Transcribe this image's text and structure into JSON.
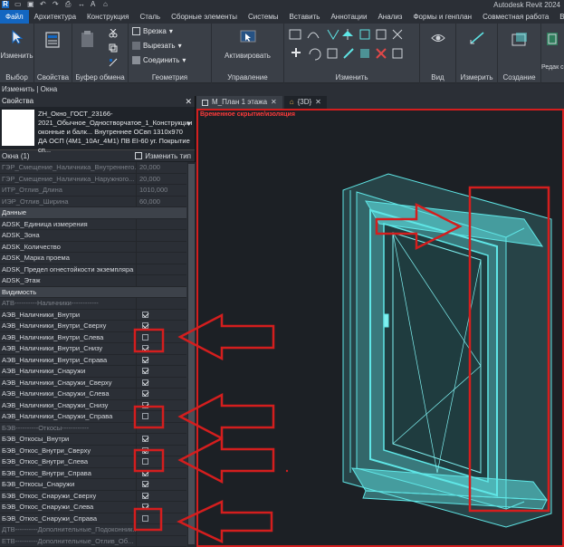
{
  "app_title": "Autodesk Revit 2024",
  "ribbon_tabs": [
    "Файл",
    "Архитектура",
    "Конструкция",
    "Сталь",
    "Сборные элементы",
    "Системы",
    "Вставить",
    "Аннотации",
    "Анализ",
    "Формы и генплан",
    "Совместная работа",
    "Вид"
  ],
  "ribbon": {
    "select_label": "Изменить",
    "select_group": "Выбор",
    "properties_group": "Свойства",
    "clipboard_group": "Буфер обмена",
    "geometry_group": "Геометрия",
    "geometry_items": [
      "Врезка",
      "Вырезать",
      "Соединить"
    ],
    "activate_label": "Активировать",
    "control_group": "Управление",
    "modify_group": "Изменить",
    "view_group": "Вид",
    "measure_group": "Измерить",
    "create_group": "Создание",
    "family_editor_label": "Редак семе"
  },
  "options_bar": "Изменить | Окна",
  "properties": {
    "header": "Свойства",
    "type_name": "ZH_Окно_ГОСТ_23166-2021_Обычное_Одностворчатое_1_Конструкции оконные и балк... Внутреннее ОСвп 1310х970 ДА ОСП (4М1_10Ar_4М1) ПВ EI-60 уг.  Покрытие сп...",
    "instance_label": "Окна (1)",
    "edit_type_label": "Изменить тип",
    "rows": [
      {
        "name": "ГЭР_Смещение_Наличника_Внутреннего...",
        "value": "20,000",
        "kind": "dim"
      },
      {
        "name": "ГЭР_Смещение_Наличника_Наружного...",
        "value": "20,000",
        "kind": "dim"
      },
      {
        "name": "ИТР_Отлив_Длина",
        "value": "1010,000",
        "kind": "dim"
      },
      {
        "name": "ИЭР_Отлив_Ширина",
        "value": "60,000",
        "kind": "dim"
      },
      {
        "name": "Данные",
        "value": "",
        "kind": "sec"
      },
      {
        "name": "ADSK_Единица измерения",
        "value": "",
        "kind": "row"
      },
      {
        "name": "ADSK_Зона",
        "value": "",
        "kind": "row"
      },
      {
        "name": "ADSK_Количество",
        "value": "",
        "kind": "row"
      },
      {
        "name": "ADSK_Марка проема",
        "value": "",
        "kind": "row"
      },
      {
        "name": "ADSK_Предел огнестойкости экземпляра",
        "value": "",
        "kind": "row"
      },
      {
        "name": "ADSK_Этаж",
        "value": "",
        "kind": "row"
      },
      {
        "name": "Видимость",
        "value": "",
        "kind": "sec"
      },
      {
        "name": "АТВ----------Наличники------------",
        "value": "",
        "kind": "sub"
      },
      {
        "name": "АЭВ_Наличники_Внутри",
        "value": "",
        "kind": "cb",
        "checked": true
      },
      {
        "name": "АЭВ_Наличники_Внутри_Сверху",
        "value": "",
        "kind": "cb",
        "checked": true
      },
      {
        "name": "АЭВ_Наличники_Внутри_Слева",
        "value": "",
        "kind": "cb",
        "checked": false
      },
      {
        "name": "АЭВ_Наличники_Внутри_Снизу",
        "value": "",
        "kind": "cb",
        "checked": true
      },
      {
        "name": "АЭВ_Наличники_Внутри_Справа",
        "value": "",
        "kind": "cb",
        "checked": true
      },
      {
        "name": "АЭВ_Наличники_Снаружи",
        "value": "",
        "kind": "cb",
        "checked": true
      },
      {
        "name": "АЭВ_Наличники_Снаружи_Сверху",
        "value": "",
        "kind": "cb",
        "checked": true
      },
      {
        "name": "АЭВ_Наличники_Снаружи_Слева",
        "value": "",
        "kind": "cb",
        "checked": true
      },
      {
        "name": "АЭВ_Наличники_Снаружи_Снизу",
        "value": "",
        "kind": "cb",
        "checked": true
      },
      {
        "name": "АЭВ_Наличники_Снаружи_Справа",
        "value": "",
        "kind": "cb",
        "checked": false
      },
      {
        "name": "БЭВ----------Откосы------------",
        "value": "",
        "kind": "sub"
      },
      {
        "name": "БЭВ_Откосы_Внутри",
        "value": "",
        "kind": "cb",
        "checked": true
      },
      {
        "name": "БЭВ_Откос_Внутри_Сверху",
        "value": "",
        "kind": "cb",
        "checked": true
      },
      {
        "name": "БЭВ_Откос_Внутри_Слева",
        "value": "",
        "kind": "cb",
        "checked": false
      },
      {
        "name": "БЭВ_Откос_Внутри_Справа",
        "value": "",
        "kind": "cb",
        "checked": true
      },
      {
        "name": "БЭВ_Откосы_Снаружи",
        "value": "",
        "kind": "cb",
        "checked": true
      },
      {
        "name": "БЭВ_Откос_Снаружи_Сверху",
        "value": "",
        "kind": "cb",
        "checked": true
      },
      {
        "name": "БЭВ_Откос_Снаружи_Слева",
        "value": "",
        "kind": "cb",
        "checked": true
      },
      {
        "name": "БЭВ_Откос_Снаружи_Справа",
        "value": "",
        "kind": "cb",
        "checked": false
      },
      {
        "name": "ДТВ----------Дополнительные_Подоконник...",
        "value": "",
        "kind": "sub"
      },
      {
        "name": "ЕТВ----------Дополнительные_Отлив_Об...",
        "value": "",
        "kind": "sub"
      }
    ]
  },
  "view_tabs": [
    "М_План 1 этажа",
    "{3D}"
  ],
  "view_banner": "Временное скрытие/изоляция",
  "colors": {
    "accent": "#1366c1",
    "highlight": "#d41e1e",
    "model": "#5fe6e6"
  }
}
